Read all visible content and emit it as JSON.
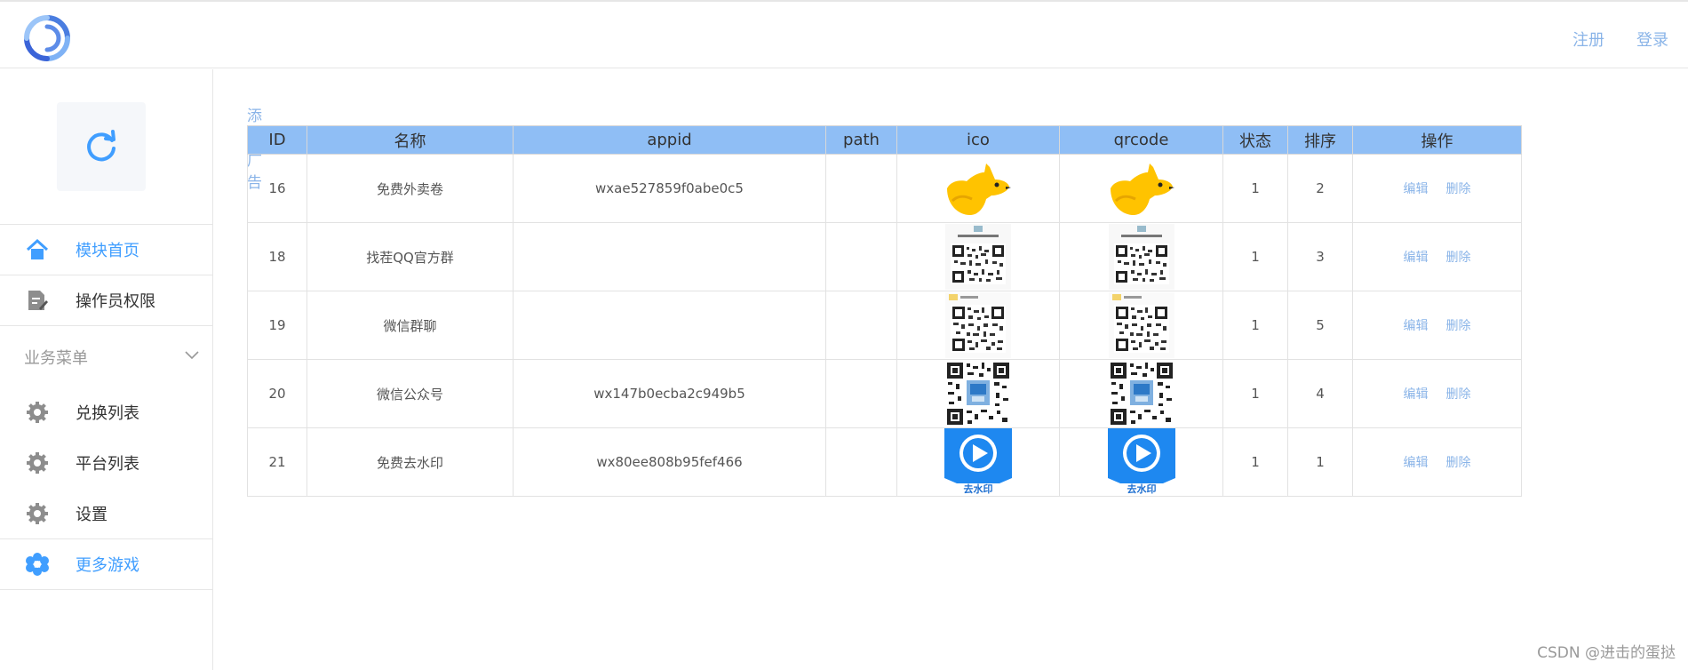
{
  "header": {
    "links": [
      "注册",
      "登录"
    ]
  },
  "sidebar": {
    "items": [
      {
        "label": "模块首页",
        "icon": "home-icon",
        "active": true
      },
      {
        "label": "操作员权限",
        "icon": "document-edit-icon",
        "active": false
      }
    ],
    "group_title": "业务菜单",
    "group_items": [
      {
        "label": "兑换列表",
        "icon": "gear-icon"
      },
      {
        "label": "平台列表",
        "icon": "gear-icon"
      },
      {
        "label": "设置",
        "icon": "gear-icon"
      }
    ],
    "more_games": {
      "label": "更多游戏",
      "icon": "flower-gear-icon"
    }
  },
  "main": {
    "add_label": "添加广告",
    "columns": [
      "ID",
      "名称",
      "appid",
      "path",
      "ico",
      "qrcode",
      "状态",
      "排序",
      "操作"
    ],
    "rows": [
      {
        "id": "16",
        "name": "免费外卖卷",
        "appid": "wxae527859f0abe0c5",
        "path": "",
        "image": "kangaroo-icon",
        "status": "1",
        "order": "2"
      },
      {
        "id": "18",
        "name": "找茬QQ官方群",
        "appid": "",
        "path": "",
        "image": "qq-group-qrcode",
        "status": "1",
        "order": "3"
      },
      {
        "id": "19",
        "name": "微信群聊",
        "appid": "",
        "path": "",
        "image": "wechat-group-qrcode",
        "status": "1",
        "order": "5"
      },
      {
        "id": "20",
        "name": "微信公众号",
        "appid": "wx147b0ecba2c949b5",
        "path": "",
        "image": "official-account-qrcode",
        "status": "1",
        "order": "4"
      },
      {
        "id": "21",
        "name": "免费去水印",
        "appid": "wx80ee808b95fef466",
        "path": "",
        "image": "play-button-icon",
        "status": "1",
        "order": "1"
      }
    ],
    "actions": {
      "edit": "编辑",
      "delete": "删除"
    },
    "watermark_caption": "去水印"
  },
  "watermark": "CSDN @进击的蛋挞",
  "colors": {
    "accent": "#409eff",
    "header_bg": "#8fbef5",
    "link": "#8ab4e8"
  }
}
